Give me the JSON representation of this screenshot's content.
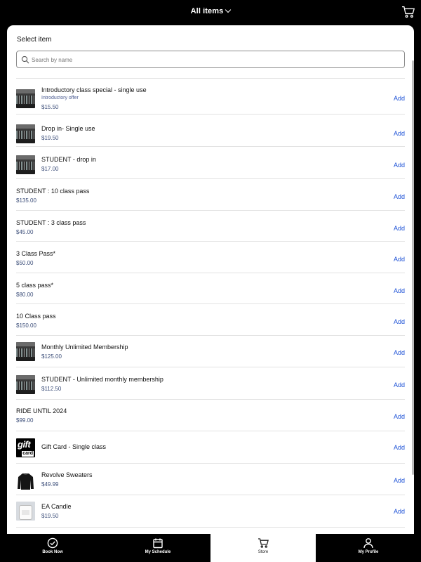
{
  "header": {
    "title": "All items"
  },
  "sheet": {
    "title": "Select item",
    "search_placeholder": "Search by name"
  },
  "items": [
    {
      "name": "Introductory class special - single use",
      "subtitle": "Introductory offer",
      "price": "$15.50",
      "add_label": "Add",
      "image": "bikes"
    },
    {
      "name": "Drop in- Single use",
      "price": "$19.50",
      "add_label": "Add",
      "image": "bikes"
    },
    {
      "name": "STUDENT - drop in",
      "price": "$17.00",
      "add_label": "Add",
      "image": "bikes"
    },
    {
      "name": "STUDENT : 10 class pass",
      "price": "$135.00",
      "add_label": "Add"
    },
    {
      "name": "STUDENT : 3 class pass",
      "price": "$45.00",
      "add_label": "Add"
    },
    {
      "name": "3 Class Pass*",
      "price": "$50.00",
      "add_label": "Add"
    },
    {
      "name": "5 class pass*",
      "price": "$80.00",
      "add_label": "Add"
    },
    {
      "name": "10 Class pass",
      "price": "$150.00",
      "add_label": "Add"
    },
    {
      "name": "Monthly Unlimited Membership",
      "price": "$125.00",
      "add_label": "Add",
      "image": "bikes"
    },
    {
      "name": "STUDENT - Unlimited monthly membership",
      "price": "$112.50",
      "add_label": "Add",
      "image": "bikes"
    },
    {
      "name": "RIDE UNTIL 2024",
      "price": "$99.00",
      "add_label": "Add"
    },
    {
      "name": "Gift Card - Single class",
      "add_label": "Add",
      "image": "gift-card",
      "image_text": [
        "gift",
        "card"
      ]
    },
    {
      "name": "Revolve Sweaters",
      "price": "$49.99",
      "add_label": "Add",
      "image": "sweater"
    },
    {
      "name": "EA Candle",
      "price": "$19.50",
      "add_label": "Add",
      "image": "candle"
    }
  ],
  "tabbar": {
    "tabs": [
      {
        "label": "Book Now",
        "icon": "check-circle-icon"
      },
      {
        "label": "My Schedule",
        "icon": "calendar-icon"
      },
      {
        "label": "Store",
        "icon": "cart-icon",
        "active": true
      },
      {
        "label": "My Profile",
        "icon": "person-icon"
      }
    ]
  },
  "colors": {
    "accent": "#1a4fd6",
    "price": "#3d4f7a",
    "background": "#000000"
  }
}
